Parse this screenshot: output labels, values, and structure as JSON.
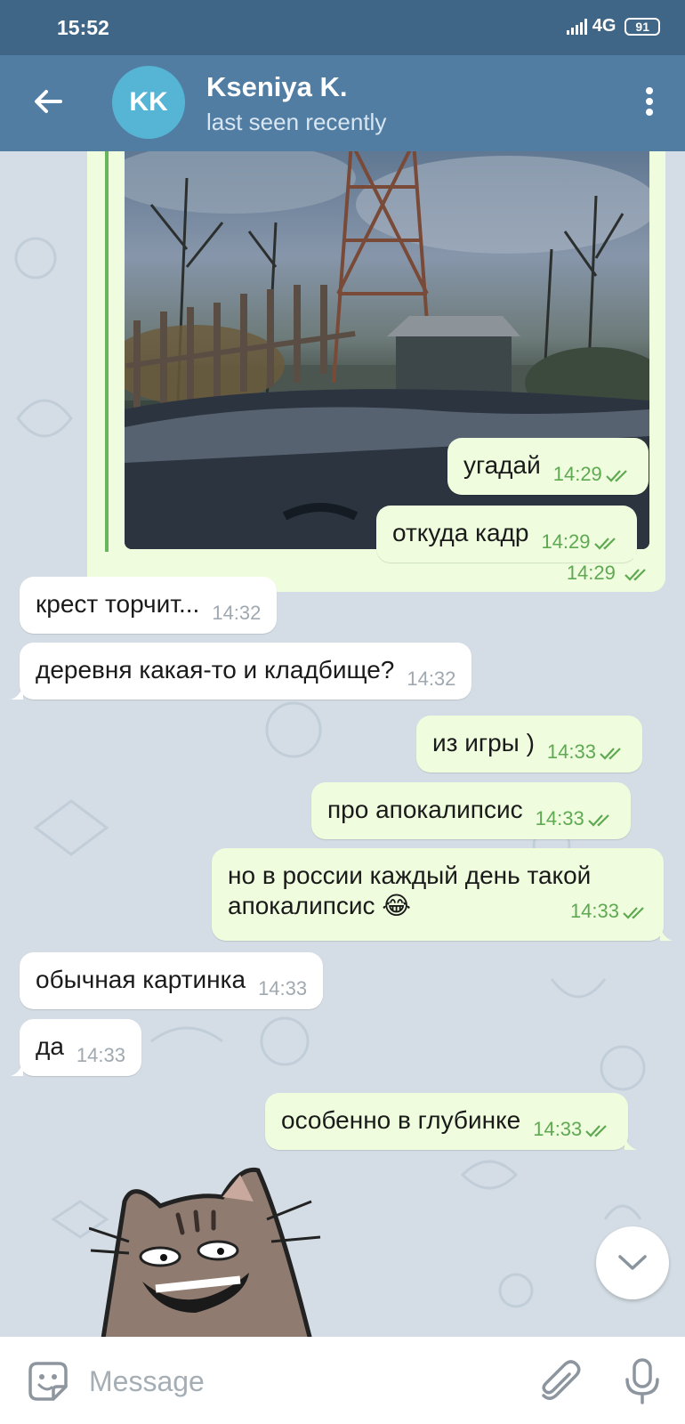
{
  "status_bar": {
    "time": "15:52",
    "network": "4G",
    "battery": "91"
  },
  "header": {
    "avatar_initials": "KK",
    "name": "Kseniya K.",
    "status": "last seen recently"
  },
  "messages": [
    {
      "dir": "out",
      "type": "media",
      "time": "14:29"
    },
    {
      "dir": "out",
      "text": "угадай",
      "time": "14:29"
    },
    {
      "dir": "out",
      "text": "откуда кадр",
      "time": "14:29"
    },
    {
      "dir": "in",
      "text": "крест торчит...",
      "time": "14:32"
    },
    {
      "dir": "in",
      "text": "деревня какая-то и кладбище?",
      "time": "14:32"
    },
    {
      "dir": "out",
      "text": "из игры )",
      "time": "14:33"
    },
    {
      "dir": "out",
      "text": "про апокалипсис",
      "time": "14:33"
    },
    {
      "dir": "out",
      "text": "но в россии каждый день такой апокалипсис 😂",
      "time": "14:33"
    },
    {
      "dir": "in",
      "text": "обычная картинка",
      "time": "14:33"
    },
    {
      "dir": "in",
      "text": "да",
      "time": "14:33"
    },
    {
      "dir": "out",
      "text": "особенно в глубинке",
      "time": "14:33"
    }
  ],
  "input": {
    "placeholder": "Message"
  },
  "colors": {
    "header": "#527da3",
    "status_bar": "#3f6686",
    "outgoing": "#effdde",
    "incoming": "#ffffff",
    "read_tick": "#5ea952"
  }
}
